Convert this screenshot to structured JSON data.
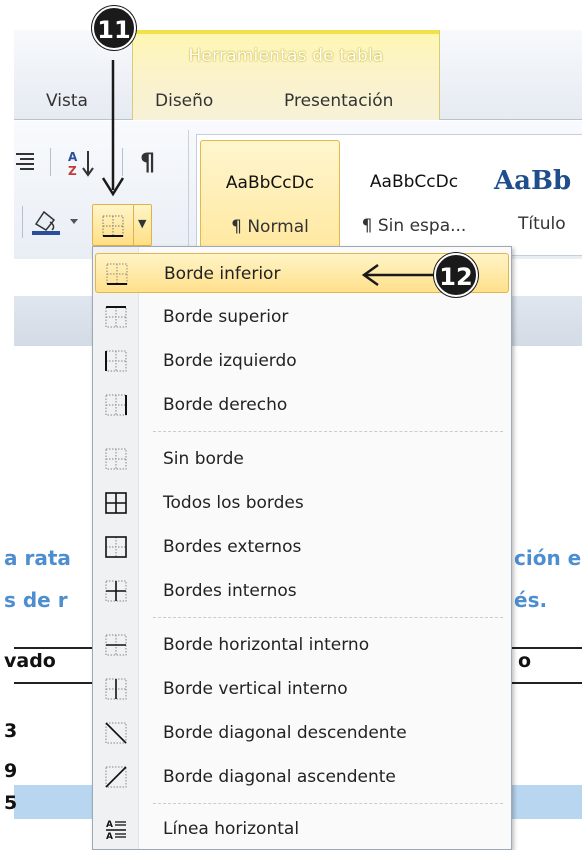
{
  "ribbon": {
    "contextual_group": "Herramientas de tabla",
    "tabs": [
      {
        "label": "Vista"
      },
      {
        "label": "Diseño"
      },
      {
        "label": "Presentación"
      }
    ],
    "styles": [
      {
        "sample": "AaBbCcDc",
        "label": "¶ Normal"
      },
      {
        "sample": "AaBbCcDc",
        "label": "¶ Sin espa..."
      },
      {
        "sample": "AaBb",
        "label": "Título"
      }
    ]
  },
  "callouts": {
    "step_11": "11",
    "step_12": "12"
  },
  "menu": {
    "items": [
      {
        "label": "Borde inferior",
        "icon": "border-bottom-icon"
      },
      {
        "label": "Borde superior",
        "icon": "border-top-icon"
      },
      {
        "label": "Borde izquierdo",
        "icon": "border-left-icon"
      },
      {
        "label": "Borde derecho",
        "icon": "border-right-icon"
      },
      {
        "label": "Sin borde",
        "icon": "no-border-icon"
      },
      {
        "label": "Todos los bordes",
        "icon": "all-borders-icon"
      },
      {
        "label": "Bordes externos",
        "icon": "outside-borders-icon"
      },
      {
        "label": "Bordes internos",
        "icon": "inside-borders-icon"
      },
      {
        "label": "Borde horizontal interno",
        "icon": "inside-horizontal-border-icon"
      },
      {
        "label": "Borde vertical interno",
        "icon": "inside-vertical-border-icon"
      },
      {
        "label": "Borde diagonal descendente",
        "icon": "diagonal-down-border-icon"
      },
      {
        "label": "Borde diagonal ascendente",
        "icon": "diagonal-up-border-icon"
      },
      {
        "label": "Línea horizontal",
        "icon": "horizontal-line-icon"
      }
    ]
  },
  "document": {
    "line1_left": "a rata",
    "line1_right": "ción e",
    "line2_left": "s de r",
    "line2_right": "és.",
    "table_header_left": "vado",
    "table_header_right": "o",
    "row_numbers": [
      "3",
      "9",
      "5"
    ]
  },
  "colors": {
    "accent_highlight": "#ffe08c",
    "context_band": "#fbf3c9",
    "link_text": "#4d8ed0"
  }
}
